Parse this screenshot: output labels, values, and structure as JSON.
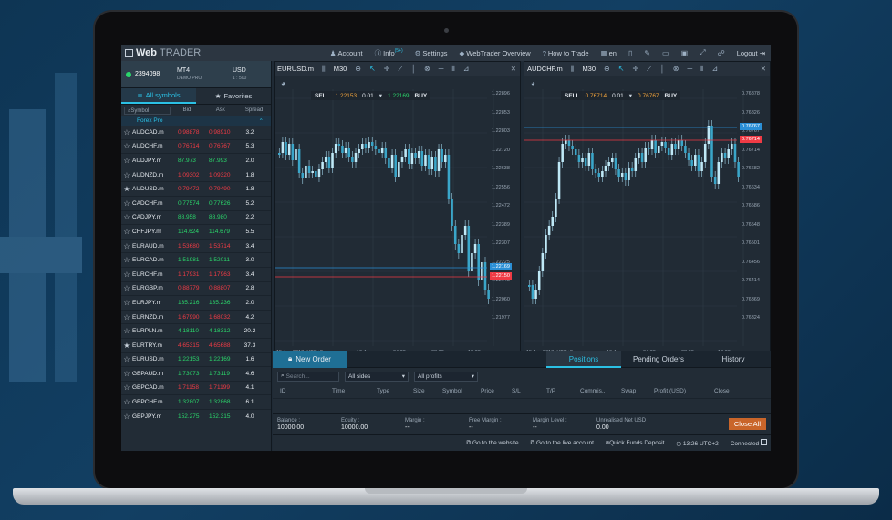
{
  "app": {
    "logo_bold": "Web",
    "logo_thin": "TRADER"
  },
  "topnav": [
    {
      "icon": "user-icon",
      "glyph": "♟",
      "label": "Account"
    },
    {
      "icon": "info-icon",
      "glyph": "ⓘ",
      "label": "Info",
      "badge": "(5+)"
    },
    {
      "icon": "gear-icon",
      "glyph": "⚙",
      "label": "Settings"
    },
    {
      "icon": "graduation-cap-icon",
      "glyph": "◆",
      "label": "WebTrader Overview"
    },
    {
      "icon": "question-icon",
      "glyph": "?",
      "label": "How to Trade"
    },
    {
      "icon": "flag-uk-icon",
      "glyph": "▦",
      "label": "en"
    },
    {
      "icon": "logout-icon",
      "glyph": "",
      "label": "Logout ⇥"
    }
  ],
  "account": {
    "id": "2394098",
    "platform": "MT4",
    "type": "DEMO PRO",
    "currency": "USD",
    "leverage": "1 : 500"
  },
  "symbol_tabs": {
    "all": "All symbols",
    "favorites": "Favorites"
  },
  "symbol_columns": {
    "search_placeholder": "Symbol",
    "bid": "Bid",
    "ask": "Ask",
    "spread": "Spread"
  },
  "group_name": "Forex Pro",
  "symbols": [
    {
      "name": "AUDCAD.m",
      "bid": "0.98878",
      "ask": "0.98910",
      "spread": "3.2",
      "color": "red",
      "fav": false
    },
    {
      "name": "AUDCHF.m",
      "bid": "0.76714",
      "ask": "0.76767",
      "spread": "5.3",
      "color": "red",
      "fav": false
    },
    {
      "name": "AUDJPY.m",
      "bid": "87.973",
      "ask": "87.993",
      "spread": "2.0",
      "color": "green",
      "fav": false
    },
    {
      "name": "AUDNZD.m",
      "bid": "1.09302",
      "ask": "1.09320",
      "spread": "1.8",
      "color": "red",
      "fav": false
    },
    {
      "name": "AUDUSD.m",
      "bid": "0.79472",
      "ask": "0.79490",
      "spread": "1.8",
      "color": "red",
      "fav": true
    },
    {
      "name": "CADCHF.m",
      "bid": "0.77574",
      "ask": "0.77626",
      "spread": "5.2",
      "color": "green",
      "fav": false
    },
    {
      "name": "CADJPY.m",
      "bid": "88.958",
      "ask": "88.980",
      "spread": "2.2",
      "color": "green",
      "fav": false
    },
    {
      "name": "CHFJPY.m",
      "bid": "114.624",
      "ask": "114.679",
      "spread": "5.5",
      "color": "green",
      "fav": false
    },
    {
      "name": "EURAUD.m",
      "bid": "1.53680",
      "ask": "1.53714",
      "spread": "3.4",
      "color": "red",
      "fav": false
    },
    {
      "name": "EURCAD.m",
      "bid": "1.51981",
      "ask": "1.52011",
      "spread": "3.0",
      "color": "green",
      "fav": false
    },
    {
      "name": "EURCHF.m",
      "bid": "1.17931",
      "ask": "1.17963",
      "spread": "3.4",
      "color": "red",
      "fav": false
    },
    {
      "name": "EURGBP.m",
      "bid": "0.88779",
      "ask": "0.88807",
      "spread": "2.8",
      "color": "red",
      "fav": false
    },
    {
      "name": "EURJPY.m",
      "bid": "135.216",
      "ask": "135.236",
      "spread": "2.0",
      "color": "green",
      "fav": false
    },
    {
      "name": "EURNZD.m",
      "bid": "1.67990",
      "ask": "1.68032",
      "spread": "4.2",
      "color": "red",
      "fav": false
    },
    {
      "name": "EURPLN.m",
      "bid": "4.18110",
      "ask": "4.18312",
      "spread": "20.2",
      "color": "green",
      "fav": false
    },
    {
      "name": "EURTRY.m",
      "bid": "4.65315",
      "ask": "4.65688",
      "spread": "37.3",
      "color": "red",
      "fav": true
    },
    {
      "name": "EURUSD.m",
      "bid": "1.22153",
      "ask": "1.22169",
      "spread": "1.6",
      "color": "green",
      "fav": false
    },
    {
      "name": "GBPAUD.m",
      "bid": "1.73073",
      "ask": "1.73119",
      "spread": "4.6",
      "color": "green",
      "fav": false
    },
    {
      "name": "GBPCAD.m",
      "bid": "1.71158",
      "ask": "1.71199",
      "spread": "4.1",
      "color": "red",
      "fav": false
    },
    {
      "name": "GBPCHF.m",
      "bid": "1.32807",
      "ask": "1.32868",
      "spread": "6.1",
      "color": "green",
      "fav": false
    },
    {
      "name": "GBPJPY.m",
      "bid": "152.275",
      "ask": "152.315",
      "spread": "4.0",
      "color": "green",
      "fav": false
    }
  ],
  "chart1": {
    "symbol": "EURUSD.m",
    "timeframe": "M30",
    "sell_label": "SELL",
    "sell_price": "1.22153",
    "lots": "0.01",
    "buy_price": "1.22169",
    "buy_label": "BUY",
    "price_ticks": [
      "1.22896",
      "1.22853",
      "1.22803",
      "1.22720",
      "1.22638",
      "1.22556",
      "1.22472",
      "1.22389",
      "1.22307",
      "1.22225",
      "1.22143",
      "1.22060",
      "1.21977"
    ],
    "bid_tag": "1.22169",
    "ask_tag": "1.22150",
    "time_ticks": [
      "15 Jan 2018, UTC+2",
      "16 Jan",
      "04:30",
      "08:30",
      "12:30"
    ],
    "candles": [
      70,
      58,
      72,
      60,
      78,
      66,
      92,
      98,
      84,
      92,
      90,
      96,
      88,
      80,
      74,
      86,
      70,
      60,
      62,
      70,
      64,
      74,
      80,
      70,
      66,
      60,
      64,
      58,
      62,
      66,
      70,
      64,
      76,
      86,
      72,
      96,
      80,
      74,
      66,
      82,
      70,
      76,
      68,
      84,
      72,
      88,
      74,
      90,
      66,
      80,
      72,
      120,
      150,
      170,
      180,
      160,
      150,
      200,
      180,
      170,
      210,
      190,
      220,
      230
    ]
  },
  "chart2": {
    "symbol": "AUDCHF.m",
    "timeframe": "M30",
    "sell_label": "SELL",
    "sell_price": "0.76714",
    "lots": "0.01",
    "buy_price": "0.76767",
    "buy_label": "BUY",
    "price_ticks": [
      "0.76878",
      "0.76826",
      "0.76767",
      "0.76714",
      "0.76682",
      "0.76634",
      "0.76586",
      "0.76548",
      "0.76501",
      "0.76456",
      "0.76414",
      "0.76369",
      "0.76324"
    ],
    "bid_tag": "0.76767",
    "ask_tag": "0.76714",
    "time_ticks": [
      "15 Jan 2018, UTC+2",
      "16 Jan",
      "04:30",
      "08:30",
      "12:30"
    ],
    "candles": [
      215,
      230,
      220,
      200,
      180,
      160,
      150,
      140,
      120,
      80,
      60,
      56,
      62,
      66,
      72,
      80,
      76,
      84,
      70,
      88,
      92,
      96,
      90,
      84,
      80,
      76,
      88,
      96,
      92,
      100,
      86,
      90,
      76,
      70,
      80,
      64,
      66,
      56,
      70,
      62,
      58,
      64,
      72,
      60,
      66,
      56,
      62,
      70,
      78,
      84,
      72,
      90,
      80,
      60,
      40,
      96,
      104,
      80,
      70,
      76,
      66,
      60,
      80,
      96
    ]
  },
  "bottom_tabs": {
    "new_order": "New Order",
    "positions": "Positions",
    "pending": "Pending Orders",
    "history": "History"
  },
  "filters": {
    "search_placeholder": "Search...",
    "sides": "All sides",
    "profits": "All profits"
  },
  "columns": [
    "ID",
    "Time",
    "Type",
    "Size",
    "Symbol",
    "Price",
    "S/L",
    "T/P",
    "Commis..",
    "Swap",
    "Profit (USD)",
    "Close"
  ],
  "summary": [
    {
      "label": "Balance :",
      "value": "10000.00"
    },
    {
      "label": "Equity :",
      "value": "10000.00"
    },
    {
      "label": "Margin :",
      "value": "--"
    },
    {
      "label": "Free Margin :",
      "value": "--"
    },
    {
      "label": "Margin Level :",
      "value": "--"
    },
    {
      "label": "Unrealised Net USD :",
      "value": "0.00"
    }
  ],
  "close_all": "Close All",
  "status": {
    "website": "Go to the website",
    "live": "Go to the live account",
    "deposit": "Quick Funds Deposit",
    "time": "13:26 UTC+2",
    "connection": "Connected"
  }
}
